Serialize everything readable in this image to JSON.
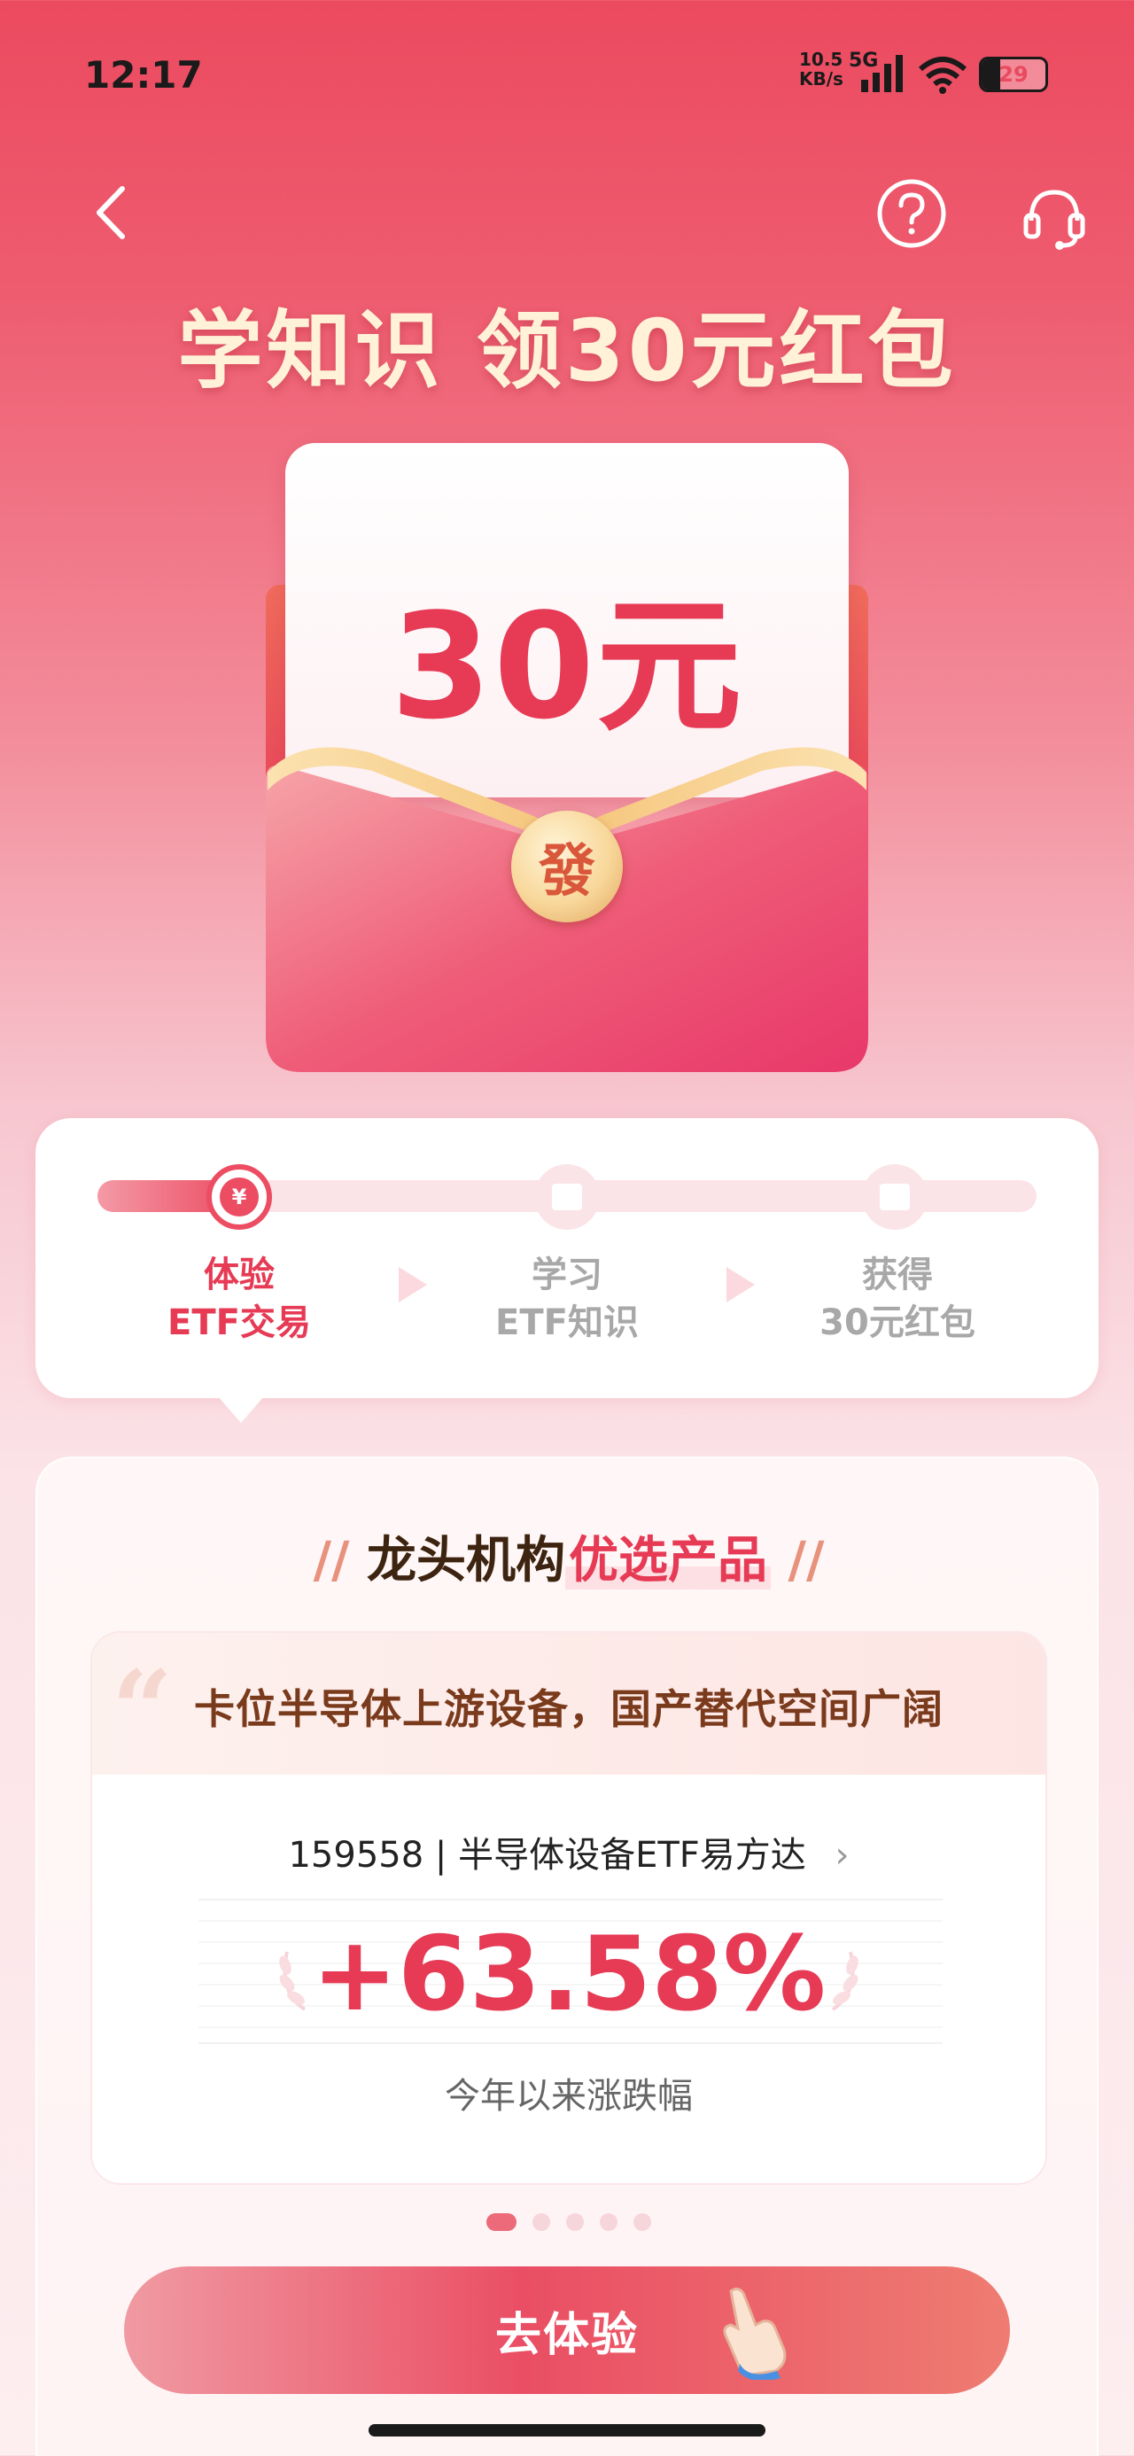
{
  "status_bar": {
    "time": "12:17",
    "net_speed": "10.5\nKB/s",
    "network": "5G",
    "battery": "29",
    "battery_level": 0.29
  },
  "header": {
    "back_icon": "back-arrow-icon",
    "help_icon": "help-circle-icon",
    "service_icon": "headset-icon",
    "headline": "学知识 领30元红包"
  },
  "envelope": {
    "amount": "30元",
    "seal": "發"
  },
  "steps": {
    "progress": 0.15,
    "items": [
      {
        "line1": "体验",
        "line2": "ETF交易",
        "state": "active"
      },
      {
        "line1": "学习",
        "line2": "ETF知识",
        "state": "inactive"
      },
      {
        "line1": "获得",
        "line2": "30元红包",
        "state": "inactive"
      }
    ]
  },
  "product": {
    "title_part1": "龙头机构",
    "title_part2": "优选产品",
    "quote": "卡位半导体上游设备，国产替代空间广阔",
    "fund_code": "159558",
    "fund_name": "半导体设备ETF易方达",
    "return_value": "+63.58%",
    "return_label": "今年以来涨跌幅",
    "page_count": 5,
    "active_page": 0
  },
  "cta": {
    "label": "去体验"
  },
  "colors": {
    "accent": "#e63a55",
    "headline": "#fff2d8"
  }
}
